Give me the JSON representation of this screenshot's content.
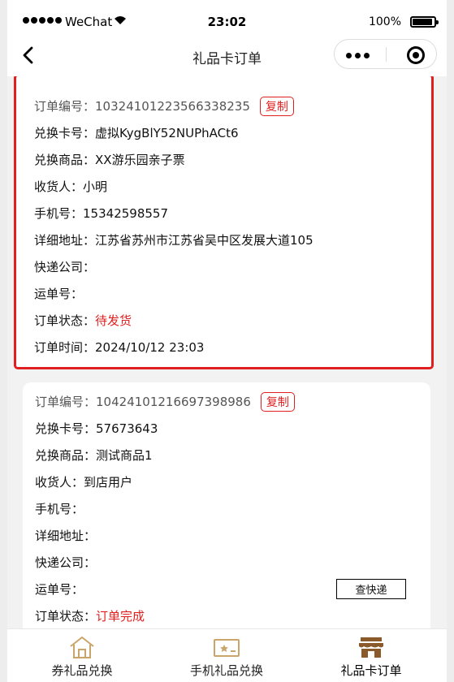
{
  "status_bar": {
    "carrier": "WeChat",
    "time": "23:02",
    "battery": "100%"
  },
  "nav": {
    "title": "礼品卡订单"
  },
  "orders": [
    {
      "order_no_label": "订单编号：",
      "order_no": "10324101223566338235",
      "copy_label": "复制",
      "card_no_label": "兑换卡号：",
      "card_no": "虚拟KygBlY52NUPhACt6",
      "product_label": "兑换商品：",
      "product": "XX游乐园亲子票",
      "receiver_label": "收货人：",
      "receiver": "小明",
      "phone_label": "手机号：",
      "phone": "15342598557",
      "address_label": "详细地址：",
      "address": "江苏省苏州市江苏省吴中区发展大道105",
      "courier_label": "快递公司：",
      "courier": "",
      "waybill_label": "运单号：",
      "waybill": "",
      "status_label": "订单状态：",
      "status": "待发货",
      "time_label": "订单时间：",
      "time": "2024/10/12 23:03"
    },
    {
      "order_no_label": "订单编号：",
      "order_no": "10424101216697398986",
      "copy_label": "复制",
      "card_no_label": "兑换卡号：",
      "card_no": "57673643",
      "product_label": "兑换商品：",
      "product": "测试商品1",
      "receiver_label": "收货人：",
      "receiver": "到店用户",
      "phone_label": "手机号：",
      "phone": "",
      "address_label": "详细地址：",
      "address": "",
      "courier_label": "快递公司：",
      "courier": "",
      "waybill_label": "运单号：",
      "waybill": "",
      "track_label": "查快递",
      "status_label": "订单状态：",
      "status": "订单完成"
    }
  ],
  "tabs": [
    {
      "label": "券礼品兑换",
      "icon": "house-icon"
    },
    {
      "label": "手机礼品兑换",
      "icon": "gift-card-icon"
    },
    {
      "label": "礼品卡订单",
      "icon": "store-icon"
    }
  ],
  "colors": {
    "accent_red": "#e02020",
    "tab_icon": "#c9a56a",
    "tab_icon_active": "#8b5a2b"
  }
}
